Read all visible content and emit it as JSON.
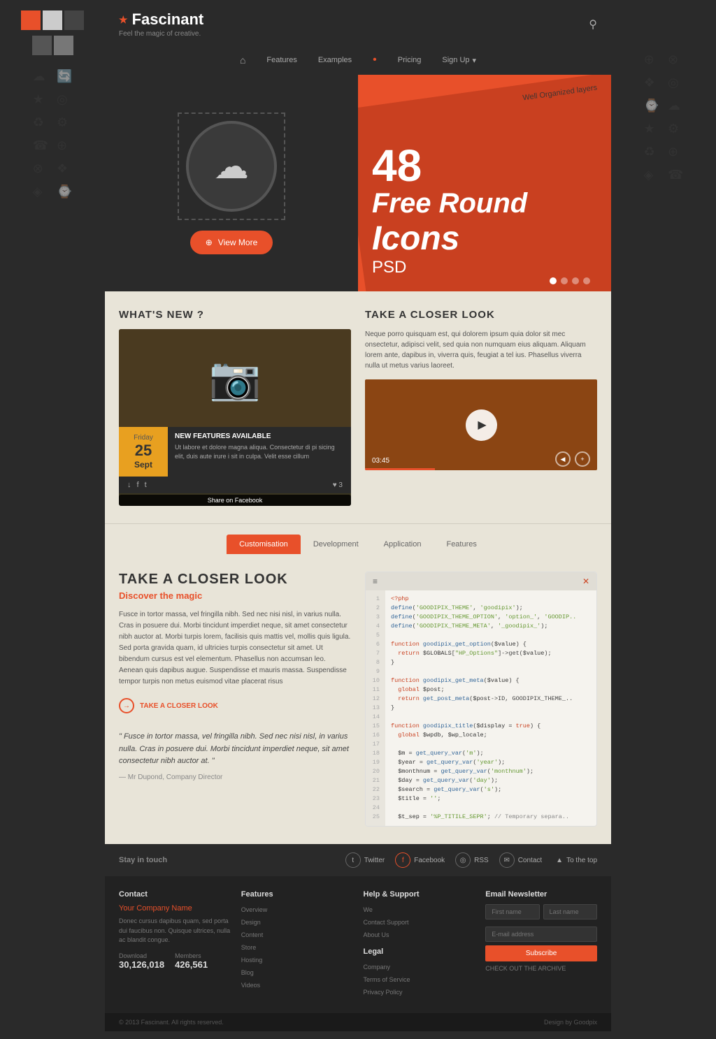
{
  "brand": {
    "name": "Fascinant",
    "tagline": "Feel the magic of creative.",
    "star": "★"
  },
  "nav": {
    "home_icon": "⌂",
    "items": [
      "Features",
      "Examples",
      "Pricing",
      "Sign Up"
    ],
    "dot": "•",
    "dropdown_icon": "▾"
  },
  "hero": {
    "view_more": "View More",
    "number": "48",
    "line1": "Free Round",
    "line2": "Icons",
    "line3": "PSD",
    "organized": "Well Organized layers"
  },
  "whats_new": {
    "title": "WHAT'S NEW ?",
    "date": {
      "day": "Friday",
      "number": "25",
      "month": "Sept"
    },
    "new_feature_label": "NEW FEATURES AVAILABLE",
    "feature_desc": "Ut labore et dolore magna aliqua. Consectetur di pi sicing elit, duis aute irure i sit in culpa. Velit esse cillum",
    "likes": "♥ 3",
    "tooltip": "Share on Facebook"
  },
  "take_closer_look": {
    "title": "TAKE A CLOSER LOOK",
    "description": "Neque porro quisquam est, qui dolorem ipsum quia dolor sit mec onsectetur, adipisci velit, sed quia non numquam eius aliquam. Aliquam lorem ante, dapibus in, viverra quis, feugiat a tel ius. Phasellus viverra nulla ut metus varius laoreet.",
    "video_time": "03:45"
  },
  "tabs": {
    "items": [
      "Customisation",
      "Development",
      "Application",
      "Features"
    ],
    "active": "Customisation"
  },
  "content_section": {
    "title": "TAKE A CLOSER LOOK",
    "subtitle": "Discover the magic",
    "body": "Fusce in tortor massa, vel fringilla nibh. Sed nec nisi nisl, in varius nulla. Cras in posuere dui. Morbi tincidunt imperdiet neque, sit amet consectetur nibh auctor at. Morbi turpis lorem, facilisis quis mattis vel, mollis quis ligula. Sed porta gravida quam, id ultricies turpis consectetur sit amet. Ut bibendum cursus est vel elementum. Phasellus non accumsan leo. Aenean quis dapibus augue. Suspendisse et mauris massa. Suspendisse tempor turpis non metus euismod vitae placerat risus",
    "link_text": "TAKE A CLOSER LOOK",
    "quote": "\" Fusce in tortor massa, vel fringilla nibh. Sed nec nisi nisl, in varius nulla. Cras in posuere dui. Morbi tincidunt imperdiet neque, sit amet consectetur nibh auctor at. \"",
    "author": "— Mr Dupond, Company Director"
  },
  "footer": {
    "stay_in_touch": "Stay in touch",
    "social": {
      "twitter": "Twitter",
      "facebook": "Facebook",
      "rss": "RSS",
      "contact": "Contact"
    },
    "to_top": "To the top",
    "contact_title": "Contact",
    "company_name": "Your Company Name",
    "company_text": "Donec cursus dapibus quam, sed porta dui faucibus non. Quisque ultrices, nulla ac blandit congue.",
    "download_label": "Download",
    "download_value": "30,126,018",
    "members_label": "Members",
    "members_value": "426,561",
    "features_title": "Features",
    "features_links": [
      "Overview",
      "Design",
      "Content",
      "Store",
      "Hosting",
      "Blog",
      "Videos"
    ],
    "help_title": "Help & Support",
    "help_links": [
      "We",
      "Contact Support",
      "About Us"
    ],
    "legal_title": "Legal",
    "legal_links": [
      "Company",
      "Terms of Service",
      "Privacy Policy"
    ],
    "newsletter_title": "Email Newsletter",
    "first_name_placeholder": "First name",
    "last_name_placeholder": "Last name",
    "email_placeholder": "E-mail address",
    "subscribe_label": "Subscribe",
    "archive_label": "CHECK OUT THE ARCHIVE",
    "copyright": "© 2013 Fascinant. All rights reserved.",
    "design_credit": "Design by Goodpix"
  },
  "code_lines": [
    "<?php",
    "define('GOODIPIX_THEME', 'goodipix');",
    "define('GOODIPIX_THEME_OPTION', 'option_', 'GOODIP..",
    "define('GOODIPIX_THEME_META', '_goodipix_');",
    "",
    "function goodipix_get_option($value) {",
    "  return $GLOBALS[\"HP_Options\"]-get($value);",
    "}",
    "",
    "function goodipix_get_meta($value) {",
    "  global $post;",
    "  return get_post_meta($post->ID, GOODIPIX_THEME_.",
    "}",
    "",
    "function goodipix_title($display = true) {",
    "  global $wpdb, $wp_locale;",
    "",
    "  $m = get_query_var('m');",
    "  $year = get_query_var('year');",
    "  $monthnum = get_query_var('monthnum');",
    "  $day = get_query_var('day');",
    "  $search = get_query_var('s');",
    "  $title = '';",
    "",
    "  $t_sep = '%P_TITILE_SEPR'; // Temporary separa.."
  ],
  "colors": {
    "orange": "#e8502a",
    "dark": "#2a2a2a",
    "bg_light": "#e8e4d8"
  },
  "swatches": [
    "#e8502a",
    "#cccccc",
    "#444444",
    "#555555",
    "#777777"
  ]
}
